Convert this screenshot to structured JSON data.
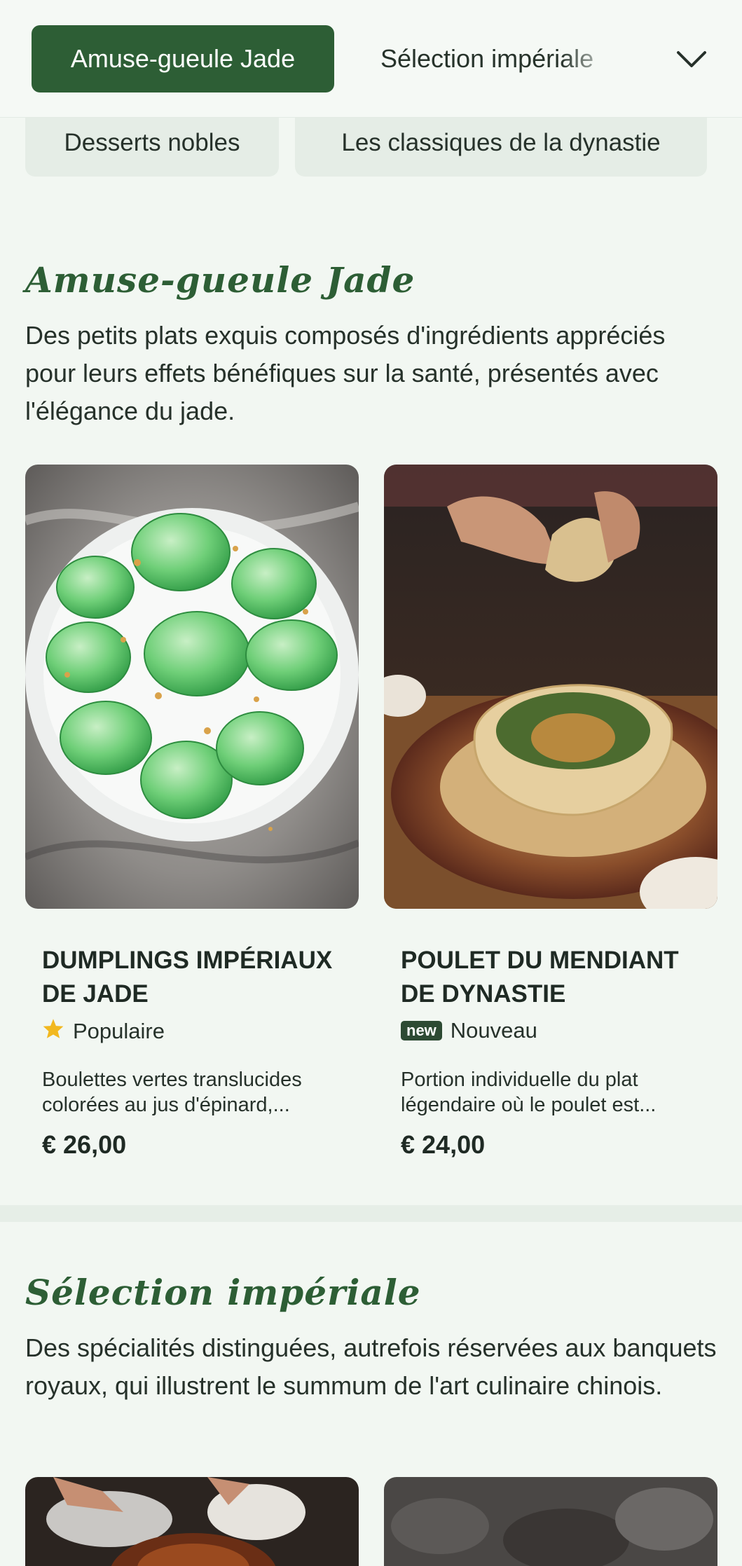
{
  "topbar": {
    "active_tab": "Amuse-gueule Jade",
    "next_tab": "Sélection impériale",
    "expand_icon": "chevron-down-icon"
  },
  "category_pills": [
    "Desserts nobles",
    "Les classiques de la dynastie"
  ],
  "sections": [
    {
      "title": "Amuse-gueule Jade",
      "description": "Des petits plats exquis composés d'ingrédients appréciés pour leurs effets bénéfiques sur la santé, présentés avec l'élégance du jade.",
      "items": [
        {
          "name": "Dumplings impériaux de jade",
          "badge_icon": "star-icon",
          "badge_label": "Populaire",
          "description": "Boulettes vertes translucides colorées au jus d'épinard,...",
          "price": "€ 26,00"
        },
        {
          "name": "Poulet du mendiant de dynastie",
          "badge_icon": "new-badge",
          "badge_tag": "new",
          "badge_label": "Nouveau",
          "description": "Portion individuelle du plat légendaire où le poulet est...",
          "price": "€ 24,00"
        }
      ]
    },
    {
      "title": "Sélection impériale",
      "description": "Des spécialités distinguées, autrefois réservées aux banquets royaux, qui illustrent le summum de l'art culinaire chinois."
    }
  ],
  "colors": {
    "accent": "#2d5e35",
    "background": "#f2f7f2",
    "pill": "#e5ede6",
    "star": "#f2b81f"
  }
}
